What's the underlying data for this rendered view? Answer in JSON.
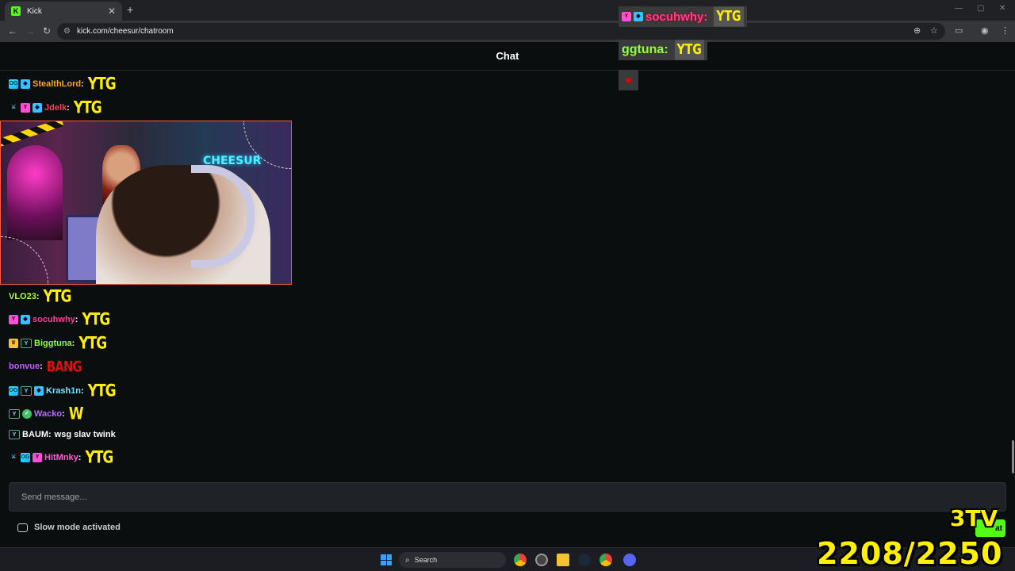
{
  "browser": {
    "tab_title": "Kick",
    "url": "kick.com/cheesur/chatroom"
  },
  "chat": {
    "title": "Chat",
    "messages": [
      {
        "user": "StealthLord",
        "color": "#f5a623",
        "emote": "YTG"
      },
      {
        "user": "Jdelk",
        "color": "#ff3c5a",
        "emote": "YTG"
      },
      {
        "user": "VLO23",
        "color": "#a8ff3b",
        "emote": "YTG"
      },
      {
        "user": "socuhwhy",
        "color": "#ff3b9a",
        "emote": "YTG"
      },
      {
        "user": "Biggtuna",
        "color": "#8dff3b",
        "emote": "YTG"
      },
      {
        "user": "bonvue",
        "color": "#c55bff",
        "emote": "BANG"
      },
      {
        "user": "Krash1n",
        "color": "#6fe8ff",
        "emote": "YTG"
      },
      {
        "user": "Wacko",
        "color": "#b76bff",
        "emote": "W"
      },
      {
        "user": "BAUM",
        "color": "#ffffff",
        "text": "wsg slav twink"
      },
      {
        "user": "HitMnky",
        "color": "#ff5ad4",
        "emote": "YTG"
      }
    ],
    "input_placeholder": "Send message...",
    "slow_mode": "Slow mode activated"
  },
  "taskbar": {
    "search_label": "Search"
  },
  "overlay": {
    "name1": "socuhwhy:",
    "name2": "ggtuna:",
    "emote": "YTG",
    "counter": "2208/2250",
    "logo": "3TV"
  },
  "colors": {
    "kick_green": "#53fc18",
    "background": "#0b0e0f"
  }
}
